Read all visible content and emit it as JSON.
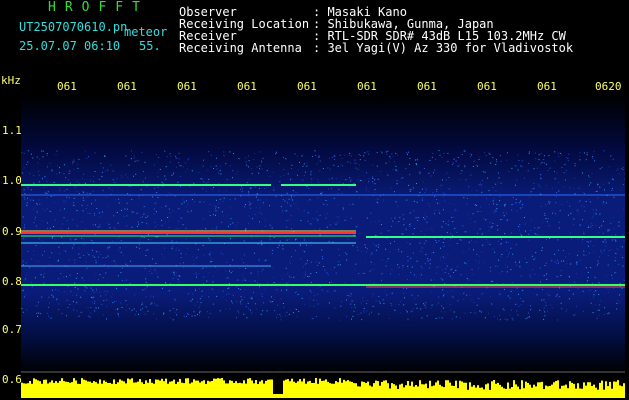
{
  "brand": "HROFFT",
  "file_name": "UT2507070610.pn",
  "file_suffix": "meteor",
  "timestamp": "25.07.07 06:10",
  "count": "55.",
  "info": [
    {
      "label": "Observer",
      "value": ": Masaki Kano"
    },
    {
      "label": "Receiving Location",
      "value": ": Shibukawa, Gunma, Japan"
    },
    {
      "label": "Receiver",
      "value": ": RTL-SDR SDR# 43dB L15 103.2MHz CW"
    },
    {
      "label": "Receiving Antenna",
      "value": ": 3el Yagi(V) Az 330 for Vladivostok"
    }
  ],
  "y_unit": "kHz",
  "y_labels": [
    "1.1",
    "1.0",
    "0.9",
    "0.8",
    "0.7",
    "0.6"
  ],
  "x_labels": [
    "061",
    "061",
    "061",
    "061",
    "061",
    "061",
    "061",
    "061",
    "061",
    "0620"
  ],
  "colors": {
    "background": "#000000",
    "spectrogram_bg": "#0a1a6e",
    "signal_strong": "#ff3333",
    "signal_mid": "#33ff66",
    "signal_weak": "#ffff33",
    "bottom_bar": "#ffff00"
  }
}
